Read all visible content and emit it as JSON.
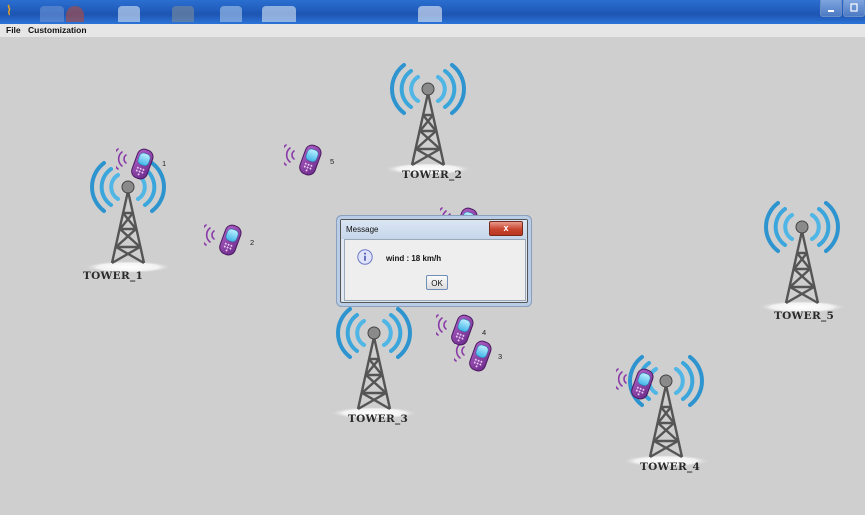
{
  "window": {
    "accent": "#1f5fc4"
  },
  "menubar": {
    "items": [
      "File",
      "Customization"
    ]
  },
  "towers": [
    {
      "label": "TOWER_1"
    },
    {
      "label": "TOWER_2"
    },
    {
      "label": "TOWER_3"
    },
    {
      "label": "TOWER_4"
    },
    {
      "label": "TOWER_5"
    }
  ],
  "phones": [
    {
      "id": "1"
    },
    {
      "id": "2"
    },
    {
      "id": "3"
    },
    {
      "id": "4"
    },
    {
      "id": "5"
    }
  ],
  "dialog": {
    "title": "Message",
    "close_label": "x",
    "message": "wind : 18 km/h",
    "ok_label": "OK",
    "icon": "info-icon"
  }
}
